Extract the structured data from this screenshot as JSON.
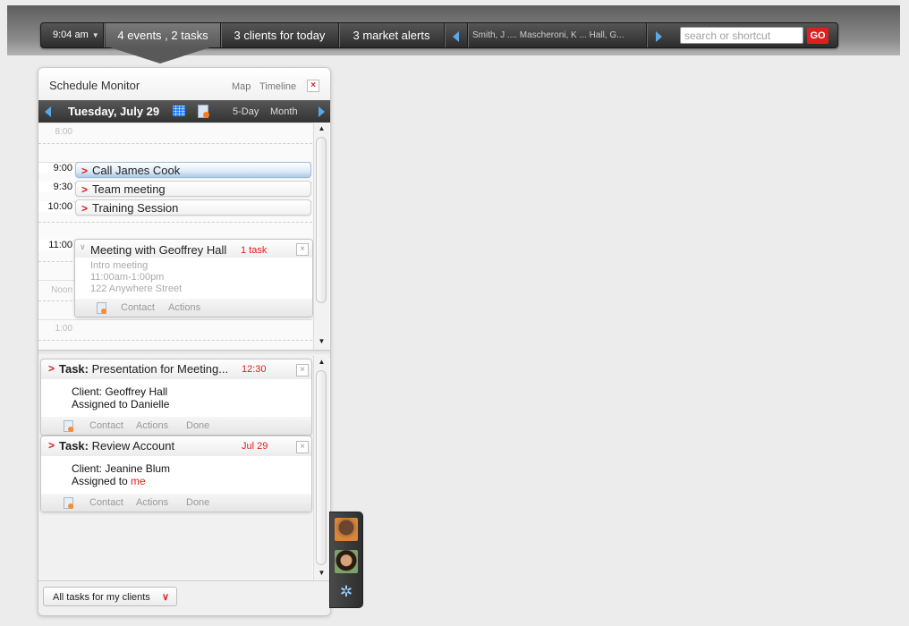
{
  "topbar": {
    "time": "9:04 am",
    "events_tasks": "4 events ,  2 tasks",
    "clients": "3 clients for today",
    "alerts": "3 market alerts",
    "names": "Smith, J .... Mascheroni, K ... Hall, G...",
    "search_placeholder": "search or shortcut",
    "go_label": "GO"
  },
  "panel": {
    "title": "Schedule Monitor",
    "map_label": "Map",
    "timeline_label": "Timeline",
    "close_label": "×",
    "date": "Tuesday,  July 29",
    "view_5day": "5-Day",
    "view_month": "Month"
  },
  "timeline": {
    "hours": [
      "8:00",
      "",
      "11:00",
      "Noon",
      "1:00"
    ],
    "events": [
      {
        "time": "9:00",
        "title": "Call James Cook",
        "selected": true
      },
      {
        "time": "9:30",
        "title": "Team meeting"
      },
      {
        "time": "10:00",
        "title": "Training Session"
      }
    ],
    "meeting": {
      "time": "11:00",
      "title": "Meeting with Geoffrey Hall",
      "tasks": "1 task",
      "details": [
        "Intro meeting",
        "11:00am-1:00pm",
        "122 Anywhere Street"
      ],
      "contact": "Contact",
      "actions": "Actions"
    }
  },
  "tasks": [
    {
      "prefix": "Task:",
      "title": " Presentation for Meeting...",
      "when": "12:30",
      "client": "Client: Geoffrey Hall",
      "assigned_prefix": "Assigned to Danielle",
      "assigned_me": "",
      "contact": "Contact",
      "actions": "Actions",
      "done": "Done"
    },
    {
      "prefix": "Task:",
      "title": " Review Account",
      "when": "Jul 29",
      "client": "Client: Jeanine Blum",
      "assigned_prefix": "Assigned to ",
      "assigned_me": "me",
      "contact": "Contact",
      "actions": "Actions",
      "done": "Done"
    }
  ],
  "filter": {
    "value": "All tasks for my clients"
  },
  "colors": {
    "accent_red": "#e02020",
    "accent_blue": "#5aa8e8",
    "toolbar": "#2c2c2c"
  },
  "icons": [
    "chevron-down-icon",
    "arrow-left-icon",
    "arrow-right-icon",
    "calendar-grid-icon",
    "add-event-icon",
    "close-icon",
    "document-icon",
    "gear-icon"
  ]
}
